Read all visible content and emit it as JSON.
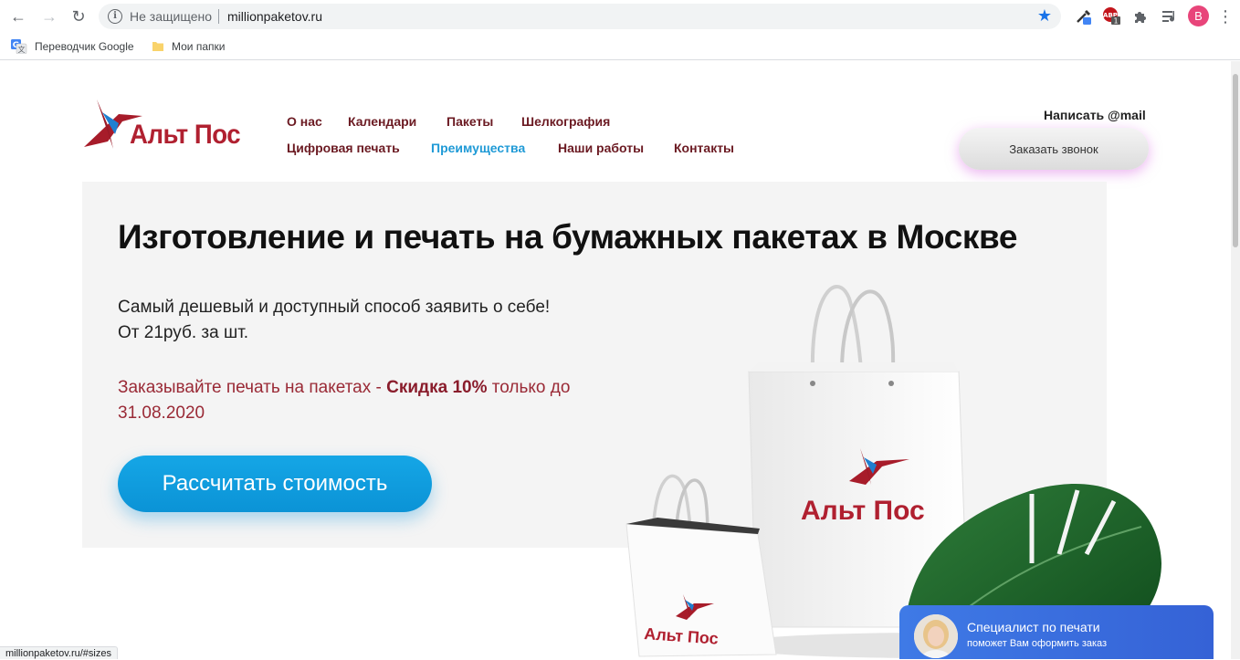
{
  "browser": {
    "security_label": "Не защищено",
    "url": "millionpaketov.ru",
    "profile_initial": "B",
    "bookmarks": [
      {
        "label": "Переводчик Google"
      },
      {
        "label": "Мои папки"
      }
    ],
    "status_url": "millionpaketov.ru/#sizes"
  },
  "site": {
    "logo_text": "Альт Пос",
    "menu": [
      {
        "label": "О нас"
      },
      {
        "label": "Календари"
      },
      {
        "label": "Пакеты"
      },
      {
        "label": "Шелкография"
      },
      {
        "label": "Цифровая печать"
      },
      {
        "label": "Преимущества",
        "active": true
      },
      {
        "label": "Наши работы"
      },
      {
        "label": "Контакты"
      }
    ],
    "write_mail": "Написать @mail",
    "callback_button": "Заказать звонок"
  },
  "hero": {
    "title": "Изготовление и печать на бумажных пакетах в Москве",
    "subtitle_line1": "Самый дешевый и доступный способ заявить о себе!",
    "subtitle_line2": "От 21руб. за шт.",
    "promo_prefix": "Заказывайте печать на пакетах - ",
    "promo_bold": "Скидка 10%",
    "promo_suffix": " только до 31.08.2020",
    "cta_button": "Рассчитать стоимость"
  },
  "bag_logo_text": "Альт Пос",
  "chat_widget": {
    "title": "Специалист по печати",
    "subtitle": "поможет Вам оформить заказ"
  },
  "colors": {
    "brand_red": "#b02030",
    "menu_text": "#6b1a22",
    "menu_active": "#1f9ad6",
    "cta_blue": "#0b93d6",
    "chat_blue": "#3562d6"
  }
}
